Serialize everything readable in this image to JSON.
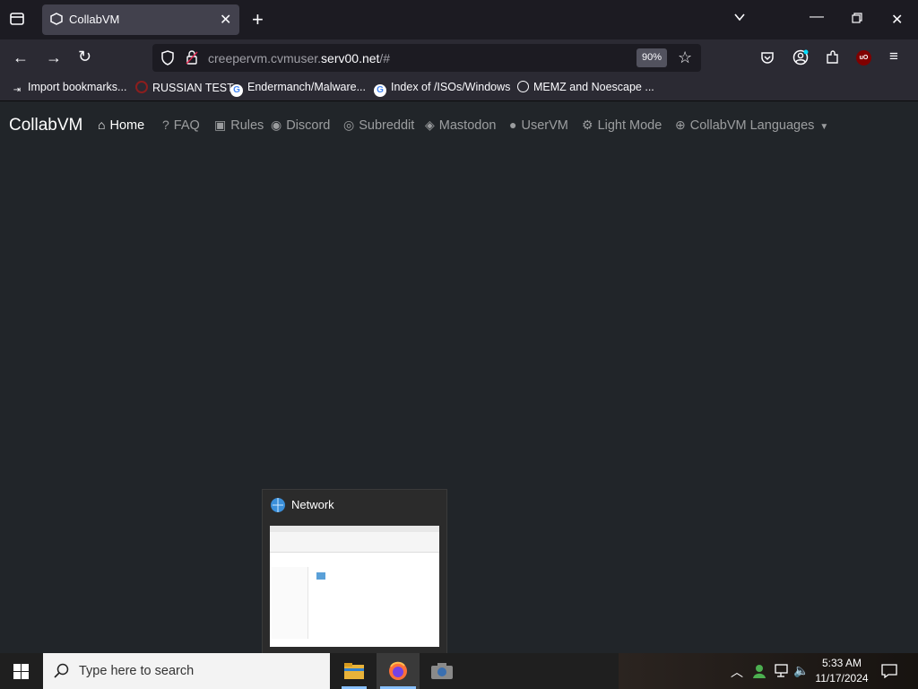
{
  "browser": {
    "tab_title": "CollabVM",
    "url_host_prefix": "creepervm.cvmuser.",
    "url_host_domain": "serv00.net",
    "url_path": "/#",
    "zoom": "90%"
  },
  "bookmarks": [
    {
      "label": "Import bookmarks...",
      "icon": "import-icon"
    },
    {
      "label": "RUSSIAN TEST",
      "icon": "site-icon"
    },
    {
      "label": "Endermanch/Malware...",
      "icon": "google-icon"
    },
    {
      "label": "Index of /ISOs/Windows",
      "icon": "google-icon"
    },
    {
      "label": "MEMZ and Noescape ...",
      "icon": "globe-icon"
    }
  ],
  "site": {
    "brand": "CollabVM",
    "nav": [
      {
        "label": "Home",
        "icon": "home-icon",
        "active": true
      },
      {
        "label": "FAQ",
        "icon": "question-icon"
      },
      {
        "label": "Rules",
        "icon": "clipboard-icon"
      },
      {
        "label": "Discord",
        "icon": "discord-icon"
      },
      {
        "label": "Subreddit",
        "icon": "reddit-icon"
      },
      {
        "label": "Mastodon",
        "icon": "mastodon-icon"
      },
      {
        "label": "UserVM",
        "icon": "user-icon"
      },
      {
        "label": "Light Mode",
        "icon": "gear-icon"
      },
      {
        "label": "CollabVM Languages",
        "icon": "globe-icon"
      }
    ]
  },
  "thumbnail": {
    "title": "Network"
  },
  "taskbar": {
    "search_placeholder": "Type here to search",
    "time": "5:33 AM",
    "date": "11/17/2024"
  }
}
